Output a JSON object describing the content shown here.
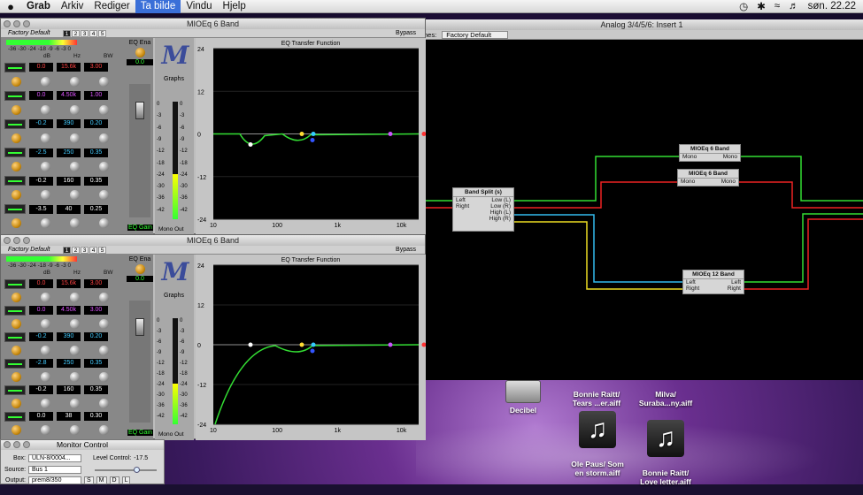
{
  "menubar": {
    "apple": "",
    "app": "Grab",
    "items": [
      "Arkiv",
      "Rediger",
      "Ta bilde",
      "Vindu",
      "Hjelp"
    ],
    "clock": "søn. 22.22"
  },
  "analog": {
    "title": "Analog 3/4/5/6: Insert 1",
    "toolbar_label": "hes:",
    "preset": "Factory Default",
    "nodes": [
      {
        "title": "Band Split (s)",
        "left": [
          "Left",
          "Right"
        ],
        "right": [
          "Low (L)",
          "Low (R)",
          "High (L)",
          "High (R)"
        ]
      },
      {
        "title": "MIOEq 6 Band",
        "left": [
          "Mono"
        ],
        "right": [
          "Mono"
        ]
      },
      {
        "title": "MIOEq 6 Band",
        "left": [
          "Mono"
        ],
        "right": [
          "Mono"
        ]
      },
      {
        "title": "MIOEq 12 Band",
        "left": [
          "Left",
          "Right"
        ],
        "right": [
          "Left",
          "Right"
        ]
      }
    ],
    "wire_colors": {
      "green": "#33dd33",
      "red": "#ee2222",
      "cyan": "#33bbee",
      "yellow": "#eedd22"
    }
  },
  "eq1": {
    "title": "MIOEq 6 Band",
    "preset": "Factory Default",
    "tabs": [
      "1",
      "2",
      "3",
      "4",
      "5"
    ],
    "bypass": "Bypass",
    "eq_ena": "EQ Ena",
    "gain_value": "0.0",
    "eq_gain": "EQ Gain",
    "graphs": "Graphs",
    "mono_out": "Mono Out",
    "scale_hdr": "-36 -30 -24 -18   -9 -6 -3  0",
    "col_db": "dB",
    "col_hz": "Hz",
    "col_bw": "BW",
    "bands": [
      [
        "0.0",
        "15.6k",
        "3.00"
      ],
      [
        "0.0",
        "4.50k",
        "1.00"
      ],
      [
        "-0.2",
        "390",
        "0.20"
      ],
      [
        "-2.5",
        "250",
        "0.35"
      ],
      [
        "-0.2",
        "160",
        "0.35"
      ],
      [
        "-3.5",
        "40",
        "0.25"
      ]
    ],
    "graph_title": "EQ Transfer Function",
    "y_ticks": [
      "24",
      "12",
      "0",
      "-12",
      "-24"
    ],
    "x_ticks": [
      "10",
      "100",
      "1k",
      "10k"
    ],
    "meter_ticks_left": [
      "0",
      "-3",
      "-6",
      "-9",
      "-12",
      "-18",
      "-24",
      "-30",
      "-36",
      "-42"
    ]
  },
  "eq2": {
    "title": "MIOEq 6 Band",
    "preset": "Factory Default",
    "tabs": [
      "1",
      "2",
      "3",
      "4",
      "5"
    ],
    "bypass": "Bypass",
    "eq_ena": "EQ Ena",
    "gain_value": "0.0",
    "eq_gain": "EQ Gain",
    "graphs": "Graphs",
    "mono_out": "Mono Out",
    "scale_hdr": "-36 -30 -24 -18   -9 -6 -3  0",
    "col_db": "dB",
    "col_hz": "Hz",
    "col_bw": "BW",
    "bands": [
      [
        "0.0",
        "15.6k",
        "3.00"
      ],
      [
        "0.0",
        "4.50k",
        "3.00"
      ],
      [
        "-0.2",
        "390",
        "0.20"
      ],
      [
        "-2.8",
        "250",
        "0.35"
      ],
      [
        "-0.2",
        "160",
        "0.35"
      ],
      [
        "0.0",
        "38",
        "0.30"
      ]
    ],
    "graph_title": "EQ Transfer Function",
    "y_ticks": [
      "24",
      "12",
      "0",
      "-12",
      "-24"
    ],
    "x_ticks": [
      "10",
      "100",
      "1k",
      "10k"
    ],
    "meter_ticks_left": [
      "0",
      "-3",
      "-6",
      "-9",
      "-12",
      "-18",
      "-24",
      "-30",
      "-36",
      "-42"
    ]
  },
  "monitor": {
    "title": "Monitor Control",
    "box_label": "Box:",
    "box_value": "ULN-8/0004...",
    "level_label": "Level Control:",
    "level_value": "-17.5",
    "source_label": "Source:",
    "source_value": "Bus 1",
    "output_label": "Output:",
    "output_value": "prem8/350",
    "buttons": [
      "S",
      "M",
      "D",
      "L"
    ]
  },
  "desktop": {
    "icons": [
      {
        "label": "Decibel"
      },
      {
        "label": "Bonnie Raitt/\nTears ...er.aiff"
      },
      {
        "label": "Milva/\nSuraba...ny.aiff"
      },
      {
        "label": "Ole Paus/ Som\nen storm.aiff"
      },
      {
        "label": "Bonnie Raitt/\nLove letter.aiff"
      }
    ]
  }
}
